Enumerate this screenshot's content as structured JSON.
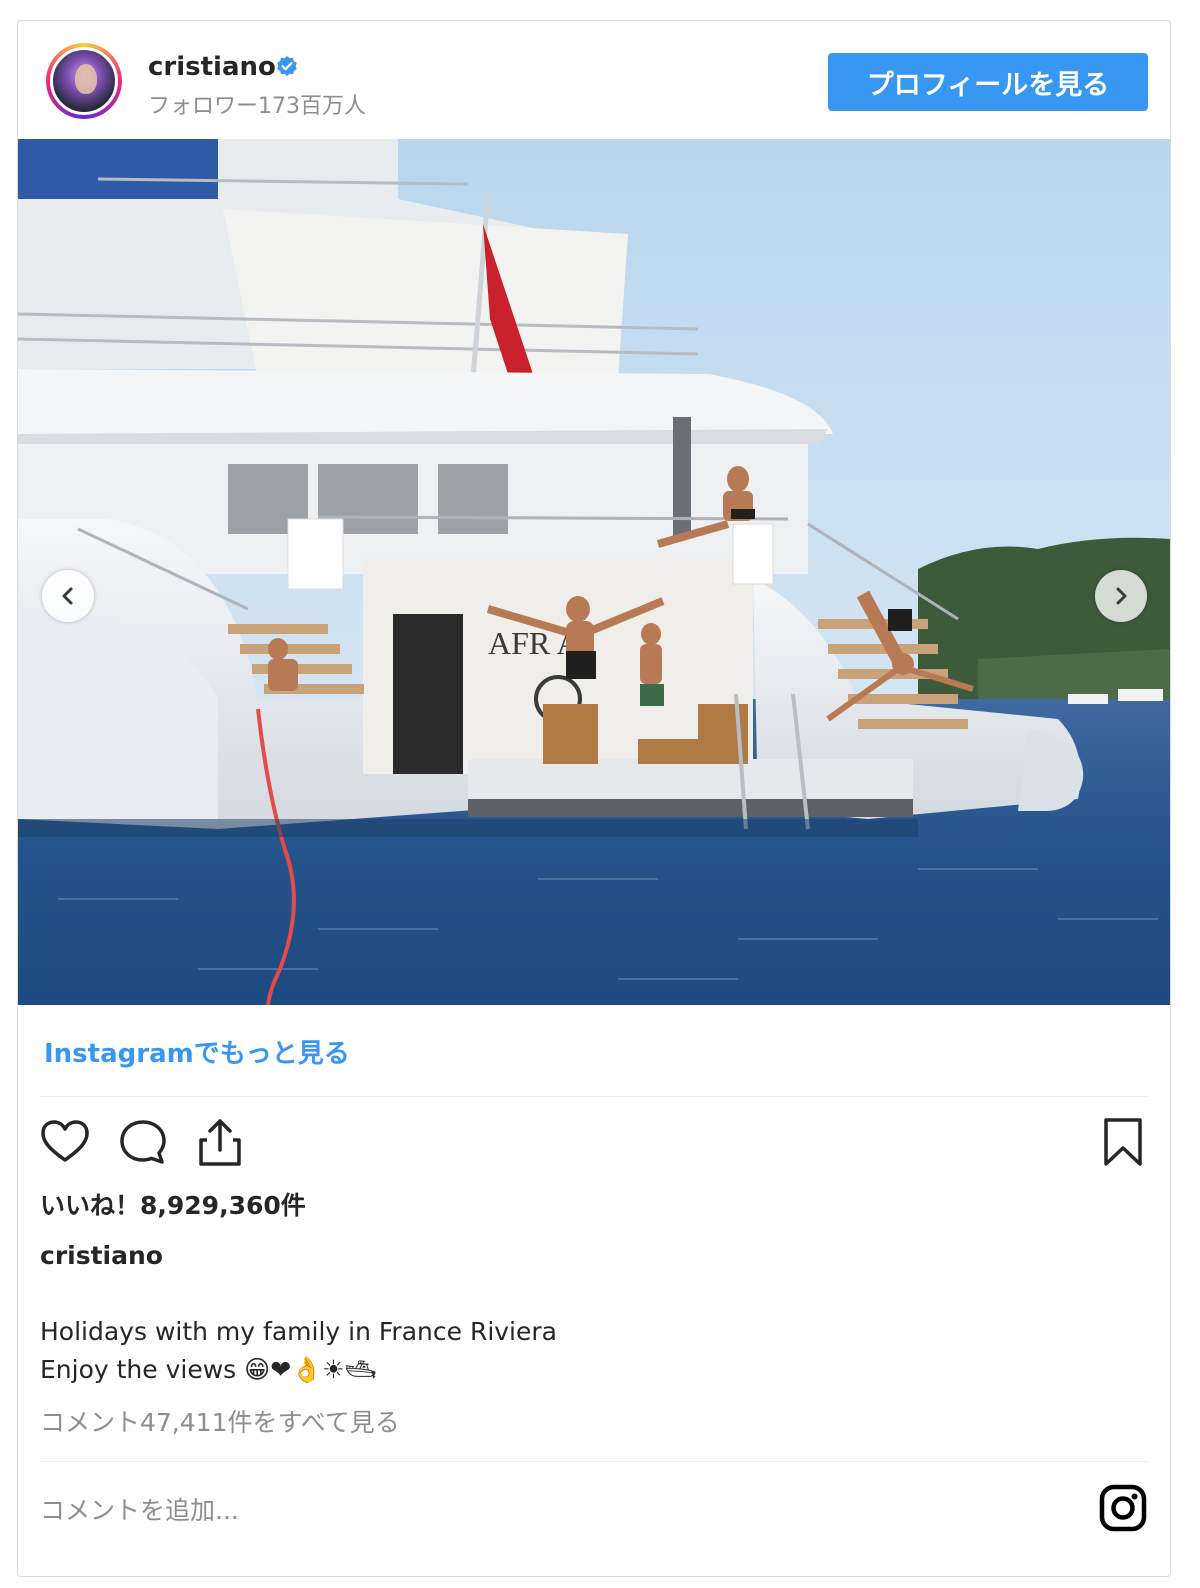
{
  "header": {
    "username": "cristiano",
    "followers": "フォロワー173百万人",
    "profile_button": "プロフィールを見る"
  },
  "photo": {
    "boat_name_text": "AFR  A"
  },
  "more_link": "Instagramでもっと見る",
  "likes": "いいね！8,929,360件",
  "caption": {
    "username": "cristiano",
    "line1": "Holidays with my family in France Riviera",
    "line2": "Enjoy the views 😁❤👌☀🛥"
  },
  "comments_link": "コメント47,411件をすべて見る",
  "comment_placeholder": "コメントを追加...",
  "colors": {
    "accent": "#3897f0",
    "text": "#262626",
    "muted": "#8e8e8e",
    "border": "#dbdbdb"
  },
  "icons": [
    "verified-badge-icon",
    "chevron-left-icon",
    "chevron-right-icon",
    "heart-icon",
    "comment-icon",
    "share-icon",
    "bookmark-icon",
    "instagram-logo-icon"
  ]
}
